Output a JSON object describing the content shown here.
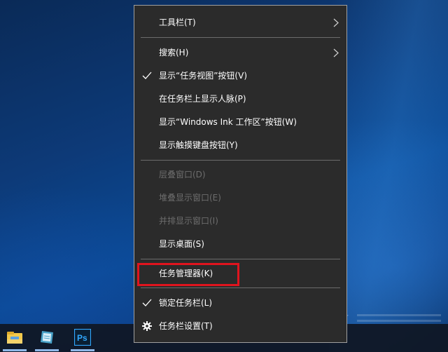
{
  "menu": {
    "items": [
      {
        "label": "工具栏(T)",
        "checked": false,
        "submenu": true,
        "disabled": false
      },
      {
        "label": "搜索(H)",
        "checked": false,
        "submenu": true,
        "disabled": false
      },
      {
        "label": "显示“任务视图”按钮(V)",
        "checked": true,
        "submenu": false,
        "disabled": false
      },
      {
        "label": "在任务栏上显示人脉(P)",
        "checked": false,
        "submenu": false,
        "disabled": false
      },
      {
        "label": "显示“Windows Ink 工作区”按钮(W)",
        "checked": false,
        "submenu": false,
        "disabled": false
      },
      {
        "label": "显示触摸键盘按钮(Y)",
        "checked": false,
        "submenu": false,
        "disabled": false
      },
      {
        "label": "层叠窗口(D)",
        "checked": false,
        "submenu": false,
        "disabled": true
      },
      {
        "label": "堆叠显示窗口(E)",
        "checked": false,
        "submenu": false,
        "disabled": true
      },
      {
        "label": "并排显示窗口(I)",
        "checked": false,
        "submenu": false,
        "disabled": true
      },
      {
        "label": "显示桌面(S)",
        "checked": false,
        "submenu": false,
        "disabled": false
      },
      {
        "label": "任务管理器(K)",
        "checked": false,
        "submenu": false,
        "disabled": false,
        "highlighted": true
      },
      {
        "label": "锁定任务栏(L)",
        "checked": true,
        "submenu": false,
        "disabled": false
      },
      {
        "label": "任务栏设置(T)",
        "checked": false,
        "submenu": false,
        "disabled": false,
        "icon": "gear-icon"
      }
    ]
  },
  "taskbar": {
    "apps": [
      {
        "icon": "file-explorer-icon"
      },
      {
        "icon": "notepad-app-icon"
      },
      {
        "icon": "photoshop-icon",
        "text": "Ps"
      }
    ]
  },
  "colors": {
    "menu_bg": "#2b2b2b",
    "menu_text": "#ffffff",
    "disabled_text": "#6d6d6d",
    "highlight_border": "#e0141e",
    "taskbar_bg": "#101826",
    "desktop_blue": "#0d3a78"
  }
}
